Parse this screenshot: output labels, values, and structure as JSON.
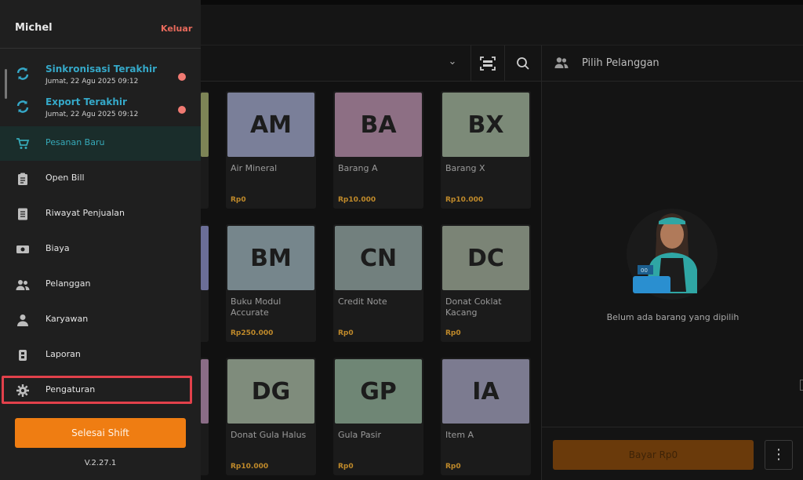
{
  "sidebar": {
    "user_name": "Michel",
    "logout_label": "Keluar",
    "sync_items": [
      {
        "title": "Sinkronisasi Terakhir",
        "date": "Jumat, 22 Agu 2025 09:12"
      },
      {
        "title": "Export Terakhir",
        "date": "Jumat, 22 Agu 2025 09:12"
      }
    ],
    "menu": [
      {
        "label": "Pesanan Baru",
        "icon": "cart-icon"
      },
      {
        "label": "Open Bill",
        "icon": "clipboard-icon"
      },
      {
        "label": "Riwayat Penjualan",
        "icon": "document-icon"
      },
      {
        "label": "Biaya",
        "icon": "money-icon"
      },
      {
        "label": "Pelanggan",
        "icon": "users-icon"
      },
      {
        "label": "Karyawan",
        "icon": "person-icon"
      },
      {
        "label": "Laporan",
        "icon": "report-icon"
      },
      {
        "label": "Pengaturan",
        "icon": "gear-icon"
      }
    ],
    "end_shift_label": "Selesai Shift",
    "version": "V.2.27.1"
  },
  "products": [
    {
      "code": "AM",
      "name": "Air Mineral",
      "price": "Rp0",
      "color": "#7a7f99"
    },
    {
      "code": "BA",
      "name": "Barang A",
      "price": "Rp10.000",
      "color": "#8d6f84"
    },
    {
      "code": "BX",
      "name": "Barang X",
      "price": "Rp10.000",
      "color": "#7c8a78"
    },
    {
      "code": "BM",
      "name": "Buku Modul Accurate",
      "price": "Rp250.000",
      "color": "#76868c"
    },
    {
      "code": "CN",
      "name": "Credit Note",
      "price": "Rp0",
      "color": "#72807e"
    },
    {
      "code": "DC",
      "name": "Donat Coklat Kacang",
      "price": "Rp0",
      "color": "#7b8476"
    },
    {
      "code": "DG",
      "name": "Donat Gula Halus",
      "price": "Rp10.000",
      "color": "#7f8c7c"
    },
    {
      "code": "GP",
      "name": "Gula Pasir",
      "price": "Rp0",
      "color": "#6f8675"
    },
    {
      "code": "IA",
      "name": "Item A",
      "price": "Rp0",
      "color": "#7c7b90"
    }
  ],
  "partial_colors": [
    "#7d8456",
    "#6b6e97",
    "#8a6c86"
  ],
  "customer": {
    "placeholder": "Pilih Pelanggan"
  },
  "cart": {
    "empty_text": "Belum ada barang yang dipilih"
  },
  "pay": {
    "label": "Bayar Rp0"
  },
  "colors": {
    "accent": "#ef7d12",
    "teal": "#35a8c8",
    "danger": "#e86a5c",
    "highlight": "#e2414b"
  }
}
